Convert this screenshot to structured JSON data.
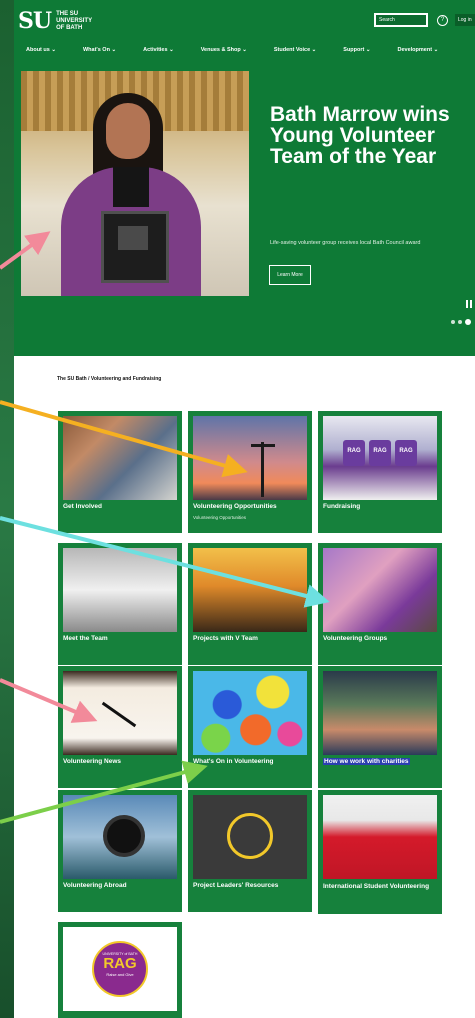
{
  "header": {
    "logo_mark": "SU",
    "logo_lines": [
      "THE SU",
      "UNIVERSITY",
      "OF BATH"
    ],
    "search_placeholder": "Search",
    "login_label": "Log in"
  },
  "nav": {
    "items": [
      {
        "label": "About us ⌄"
      },
      {
        "label": "What's On ⌄"
      },
      {
        "label": "Activities ⌄"
      },
      {
        "label": "Venues & Shop ⌄"
      },
      {
        "label": "Student Voice ⌄"
      },
      {
        "label": "Support ⌄"
      },
      {
        "label": "Development ⌄"
      }
    ]
  },
  "hero": {
    "title": "Bath Marrow wins Young Volunteer Team of the Year",
    "subtitle": "Life-saving volunteer group receives local Bath Council award",
    "button_label": "Learn More"
  },
  "breadcrumb": "The SU Bath / Volunteering and Fundraising",
  "cards": [
    {
      "label": "Get Involved"
    },
    {
      "label": "Volunteering Opportunities",
      "sublabel": "Volunteering Opportunities"
    },
    {
      "label": "Fundraising",
      "bag_text": "RAG"
    },
    {
      "label": "Meet the Team"
    },
    {
      "label": "Projects with V Team"
    },
    {
      "label": "Volunteering Groups"
    },
    {
      "label": "Volunteering News"
    },
    {
      "label": "What's On in Volunteering"
    },
    {
      "label": "How we work with charities"
    },
    {
      "label": "Volunteering Abroad"
    },
    {
      "label": "Project Leaders' Resources"
    },
    {
      "label": "International Student Volunteering"
    },
    {
      "label": "",
      "rag_top": "UNIVERSITY of BATH",
      "rag_word": "RAG",
      "rag_sub": "Raise and Give"
    }
  ],
  "colors": {
    "brand_green": "#0e7a36",
    "card_green": "#16813c",
    "arrow_pink": "#f28a9a",
    "arrow_orange": "#f5b021",
    "arrow_cyan": "#6de0e0",
    "arrow_lime": "#7ccf4a"
  },
  "icons": [
    "help-icon",
    "pause-icon",
    "carousel-dots"
  ]
}
